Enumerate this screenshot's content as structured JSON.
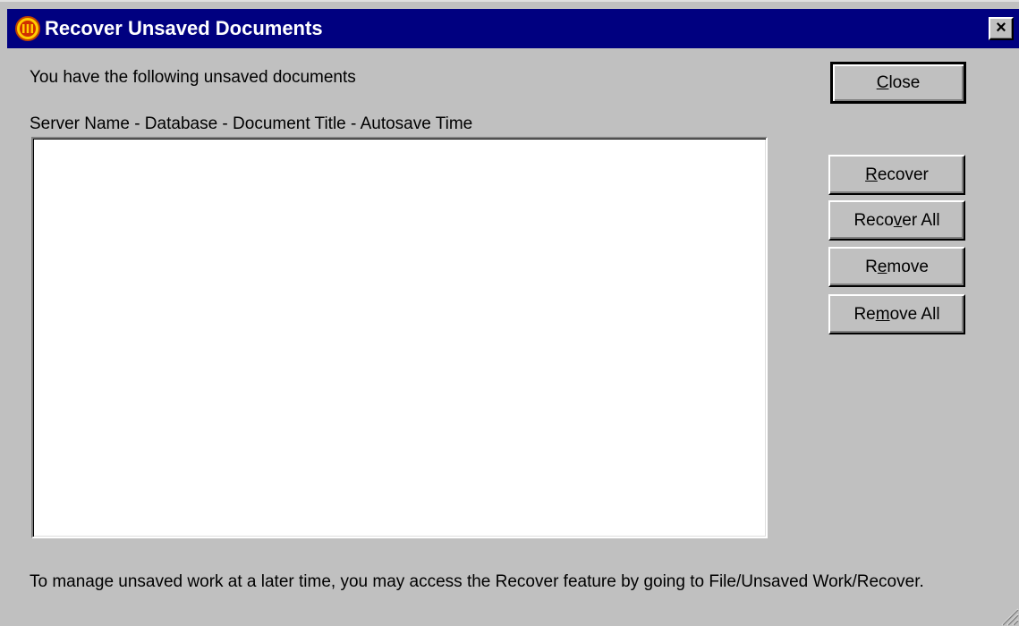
{
  "window": {
    "title": "Recover Unsaved Documents",
    "close_glyph": "×"
  },
  "main": {
    "intro_text": "You have the following unsaved documents",
    "list_header": "Server Name - Database - Document Title - Autosave Time",
    "list_items": []
  },
  "buttons": {
    "close": {
      "pre": "",
      "key": "C",
      "post": "lose"
    },
    "recover": {
      "pre": "",
      "key": "R",
      "post": "ecover"
    },
    "recover_all": {
      "pre": "Reco",
      "key": "v",
      "post": "er All"
    },
    "remove": {
      "pre": "R",
      "key": "e",
      "post": "move"
    },
    "remove_all": {
      "pre": "Re",
      "key": "m",
      "post": "ove All"
    }
  },
  "footer": {
    "text": "To manage unsaved work at a later time, you may access the Recover feature by going to File/Unsaved Work/Recover."
  },
  "colors": {
    "titlebar": "#000080",
    "face": "#c0c0c0",
    "icon_accent": "#ffcc00"
  },
  "icons": {
    "app": "app-logo-icon",
    "close": "close-icon",
    "resize": "resize-grip-icon"
  }
}
